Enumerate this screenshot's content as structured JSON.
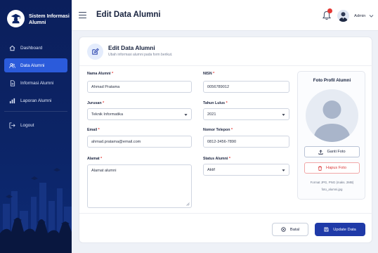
{
  "brand": {
    "line1": "Sistem Informasi",
    "line2": "Alumni"
  },
  "nav": [
    {
      "label": "Dashboard",
      "icon": "home-icon",
      "active": false
    },
    {
      "label": "Data Alumni",
      "icon": "users-icon",
      "active": true
    },
    {
      "label": "Informasi Alumni",
      "icon": "document-icon",
      "active": false
    },
    {
      "label": "Laporan Alumni",
      "icon": "bar-chart-icon",
      "active": false
    },
    {
      "label": "Logout",
      "icon": "logout-icon",
      "active": false
    }
  ],
  "header": {
    "title": "Edit Data Alumni",
    "user": "Admin"
  },
  "form": {
    "title": "Edit Data Alumni",
    "subtitle": "Ubah informasi alumni pada form berikut.",
    "nama": {
      "label": "Nama Alumni",
      "value": "Ahmad Pratama"
    },
    "nisn": {
      "label": "NISN",
      "value": "0056789012"
    },
    "jurusan": {
      "label": "Jurusan",
      "value": "Teknik Informatika"
    },
    "tahun": {
      "label": "Tahun Lulus",
      "value": "2021"
    },
    "email": {
      "label": "Email",
      "value": "ahmad.pratama@email.com"
    },
    "telepon": {
      "label": "Nomor Telepon",
      "value": "0812-3456-7890"
    },
    "alamat": {
      "label": "Alamat",
      "value": "Alamat alumni"
    },
    "status": {
      "label": "Status Alumni",
      "value": "Aktif"
    },
    "required_mark": "*"
  },
  "photo": {
    "title": "Foto Profil Alumni",
    "change_label": "Ganti Foto",
    "delete_label": "Hapus Foto",
    "format_note": "Format JPG, PNG (maks. 2MB)",
    "filename": "foto_alumni.jpg"
  },
  "actions": {
    "cancel": "Batal",
    "submit": "Update Data"
  },
  "colors": {
    "sidebar": "#0b1f5c",
    "accent": "#2b5bdb",
    "primary_button": "#1f3aa8",
    "danger": "#d93636",
    "notification": "#e53935"
  }
}
